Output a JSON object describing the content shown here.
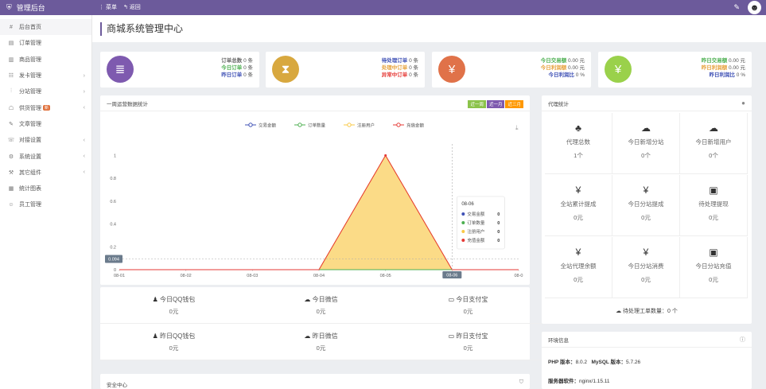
{
  "topbar": {
    "brand": "管理后台",
    "menu_label": "菜单",
    "back_label": "返回"
  },
  "sidebar": {
    "items": [
      {
        "icon": "#",
        "label": "后台首页"
      },
      {
        "icon": "▤",
        "label": "订单管理"
      },
      {
        "icon": "▥",
        "label": "商品管理"
      },
      {
        "icon": "☷",
        "label": "发卡管理"
      },
      {
        "icon": "⫶",
        "label": "分站管理"
      },
      {
        "icon": "☖",
        "label": "供货管理",
        "badge": "新"
      },
      {
        "icon": "✎",
        "label": "文章管理"
      },
      {
        "icon": "☏",
        "label": "对接设置"
      },
      {
        "icon": "⚙",
        "label": "系统设置"
      },
      {
        "icon": "⚒",
        "label": "其它组件"
      },
      {
        "icon": "▦",
        "label": "统计图表"
      },
      {
        "icon": "☺",
        "label": "员工管理"
      }
    ]
  },
  "page": {
    "title": "商城系统管理中心"
  },
  "stats": [
    {
      "color": "#7e5aaf",
      "icon": "≣",
      "lines": [
        {
          "label": "订单总数",
          "value": "0",
          "unit": "条",
          "color": "#666"
        },
        {
          "label": "今日订单",
          "value": "0",
          "unit": "条",
          "color": "#4caf50"
        },
        {
          "label": "昨日订单",
          "value": "0",
          "unit": "条",
          "color": "#3f51b5"
        }
      ]
    },
    {
      "color": "#d8a83f",
      "icon": "⧗",
      "lines": [
        {
          "label": "待处理订单",
          "value": "0",
          "unit": "条",
          "color": "#3f51b5"
        },
        {
          "label": "处理中订单",
          "value": "0",
          "unit": "条",
          "color": "#e6a23c"
        },
        {
          "label": "异常中订单",
          "value": "0",
          "unit": "条",
          "color": "#e53935"
        }
      ]
    },
    {
      "color": "#e07249",
      "icon": "¥",
      "lines": [
        {
          "label": "今日交易额",
          "value": "0.00",
          "unit": "元",
          "color": "#4caf50"
        },
        {
          "label": "今日利润额",
          "value": "0.00",
          "unit": "元",
          "color": "#e6a23c"
        },
        {
          "label": "今日利润比",
          "value": "0",
          "unit": "%",
          "color": "#3f51b5"
        }
      ]
    },
    {
      "color": "#9ad14b",
      "icon": "¥",
      "lines": [
        {
          "label": "昨日交易额",
          "value": "0.00",
          "unit": "元",
          "color": "#4caf50"
        },
        {
          "label": "昨日利润额",
          "value": "0.00",
          "unit": "元",
          "color": "#e6a23c"
        },
        {
          "label": "昨日利润比",
          "value": "0",
          "unit": "%",
          "color": "#3f51b5"
        }
      ]
    }
  ],
  "chart_panel": {
    "title": "一周运营数据统计",
    "periods": [
      {
        "label": "近一周",
        "color": "#8bc34a"
      },
      {
        "label": "近一月",
        "color": "#7e5aaf"
      },
      {
        "label": "近三月",
        "color": "#ff9800"
      }
    ],
    "tooltip": {
      "date": "08-06",
      "rows": [
        {
          "label": "交易金额",
          "value": "0",
          "color": "#3f51b5"
        },
        {
          "label": "订单数量",
          "value": "0",
          "color": "#4caf50"
        },
        {
          "label": "注册用户",
          "value": "0",
          "color": "#f9c846"
        },
        {
          "label": "充值金额",
          "value": "0",
          "color": "#e53935"
        }
      ]
    },
    "pointer_y_label": "0.094",
    "pointer_x_label": "08-06"
  },
  "chart_data": {
    "type": "area",
    "x": [
      "08-01",
      "08-02",
      "08-03",
      "08-04",
      "08-05",
      "08-06",
      "08-0"
    ],
    "yticks": [
      "0",
      "0.2",
      "0.4",
      "0.6",
      "0.8",
      "1"
    ],
    "ylim": [
      0,
      1.1
    ],
    "legend": "top-center",
    "series": [
      {
        "name": "交易金额",
        "color": "#3f51b5",
        "values": [
          0,
          0,
          0,
          0,
          0,
          0,
          0
        ]
      },
      {
        "name": "订单数量",
        "color": "#4caf50",
        "values": [
          0,
          0,
          0,
          0,
          0,
          0,
          0
        ]
      },
      {
        "name": "注册用户",
        "color": "#f9c846",
        "values": [
          0,
          0,
          0,
          0,
          1,
          0,
          0
        ],
        "area": true
      },
      {
        "name": "充值金额",
        "color": "#e53935",
        "values": [
          0,
          0,
          0,
          0,
          1,
          0,
          0
        ]
      }
    ]
  },
  "payments": [
    {
      "icon": "♟",
      "label": "今日QQ钱包",
      "value": "0元"
    },
    {
      "icon": "☁",
      "label": "今日微信",
      "value": "0元"
    },
    {
      "icon": "▭",
      "label": "今日支付宝",
      "value": "0元"
    },
    {
      "icon": "♟",
      "label": "昨日QQ钱包",
      "value": "0元"
    },
    {
      "icon": "☁",
      "label": "昨日微信",
      "value": "0元"
    },
    {
      "icon": "▭",
      "label": "昨日支付宝",
      "value": "0元"
    }
  ],
  "security": {
    "title": "安全中心"
  },
  "agent": {
    "title": "代理统计",
    "cells": [
      {
        "icon": "♣",
        "label": "代理总数",
        "value": "1个"
      },
      {
        "icon": "☁",
        "label": "今日新增分站",
        "value": "0个"
      },
      {
        "icon": "☁",
        "label": "今日新增用户",
        "value": "0个"
      },
      {
        "icon": "¥",
        "label": "全站累计提成",
        "value": "0元"
      },
      {
        "icon": "¥",
        "label": "今日分站提成",
        "value": "0元"
      },
      {
        "icon": "▣",
        "label": "待处理提现",
        "value": "0元"
      },
      {
        "icon": "¥",
        "label": "全站代理余额",
        "value": "0元"
      },
      {
        "icon": "¥",
        "label": "今日分站消费",
        "value": "0元"
      },
      {
        "icon": "▣",
        "label": "今日分站充值",
        "value": "0元"
      }
    ],
    "footer": "待处理工单数量：0 个"
  },
  "env": {
    "title": "环境信息",
    "php_label": "PHP 版本：",
    "php_value": "8.0.2",
    "mysql_label": "MySQL 版本：",
    "mysql_value": "5.7.26",
    "server_label": "服务器软件：",
    "server_value": "nginx/1.15.11"
  }
}
